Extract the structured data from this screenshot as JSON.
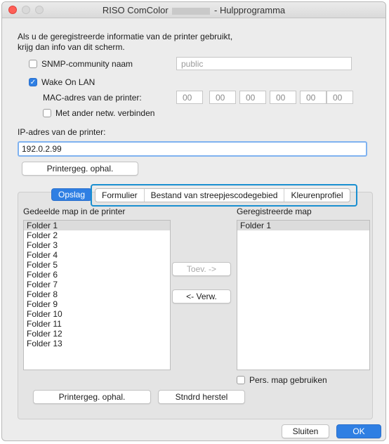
{
  "window": {
    "title_prefix": "RISO ComColor",
    "title_suffix": "- Hulpprogramma"
  },
  "intro": {
    "line1": "Als u de geregistreerde informatie van de printer gebruikt,",
    "line2": "krijg dan info van dit scherm."
  },
  "snmp": {
    "label": "SNMP-community naam",
    "checked": false,
    "value": "public"
  },
  "wol": {
    "label": "Wake On LAN",
    "checked": true,
    "mac_label": "MAC-adres van de printer:",
    "mac_parts": [
      "00",
      "00",
      "00",
      "00",
      "00",
      "00"
    ],
    "other_net_label": "Met ander netw. verbinden",
    "other_net_checked": false
  },
  "ip": {
    "label": "IP-adres van de printer:",
    "value": "192.0.2.99",
    "fetch_label": "Printergeg. ophal."
  },
  "tabs": [
    "Opslag",
    "Formulier",
    "Bestand van streepjescodegebied",
    "Kleurenprofiel"
  ],
  "tabs_active": "Opslag",
  "shared": {
    "label": "Gedeelde map in de printer",
    "items": [
      "Folder 1",
      "Folder 2",
      "Folder 3",
      "Folder 4",
      "Folder 5",
      "Folder 6",
      "Folder 7",
      "Folder 8",
      "Folder 9",
      "Folder 10",
      "Folder 11",
      "Folder 12",
      "Folder 13"
    ]
  },
  "registered": {
    "label": "Geregistreerde map",
    "items": [
      "Folder 1"
    ]
  },
  "move": {
    "add_label": "Toev. ->",
    "remove_label": "<- Verw."
  },
  "personal_folder": {
    "label": "Pers. map gebruiken",
    "checked": false
  },
  "bottom": {
    "fetch_label": "Printergeg. ophal.",
    "reset_label": "Stndrd herstel"
  },
  "footer": {
    "close_label": "Sluiten",
    "ok_label": "OK"
  },
  "colors": {
    "accent": "#2f7fe3",
    "highlight": "#1a8fd0"
  }
}
